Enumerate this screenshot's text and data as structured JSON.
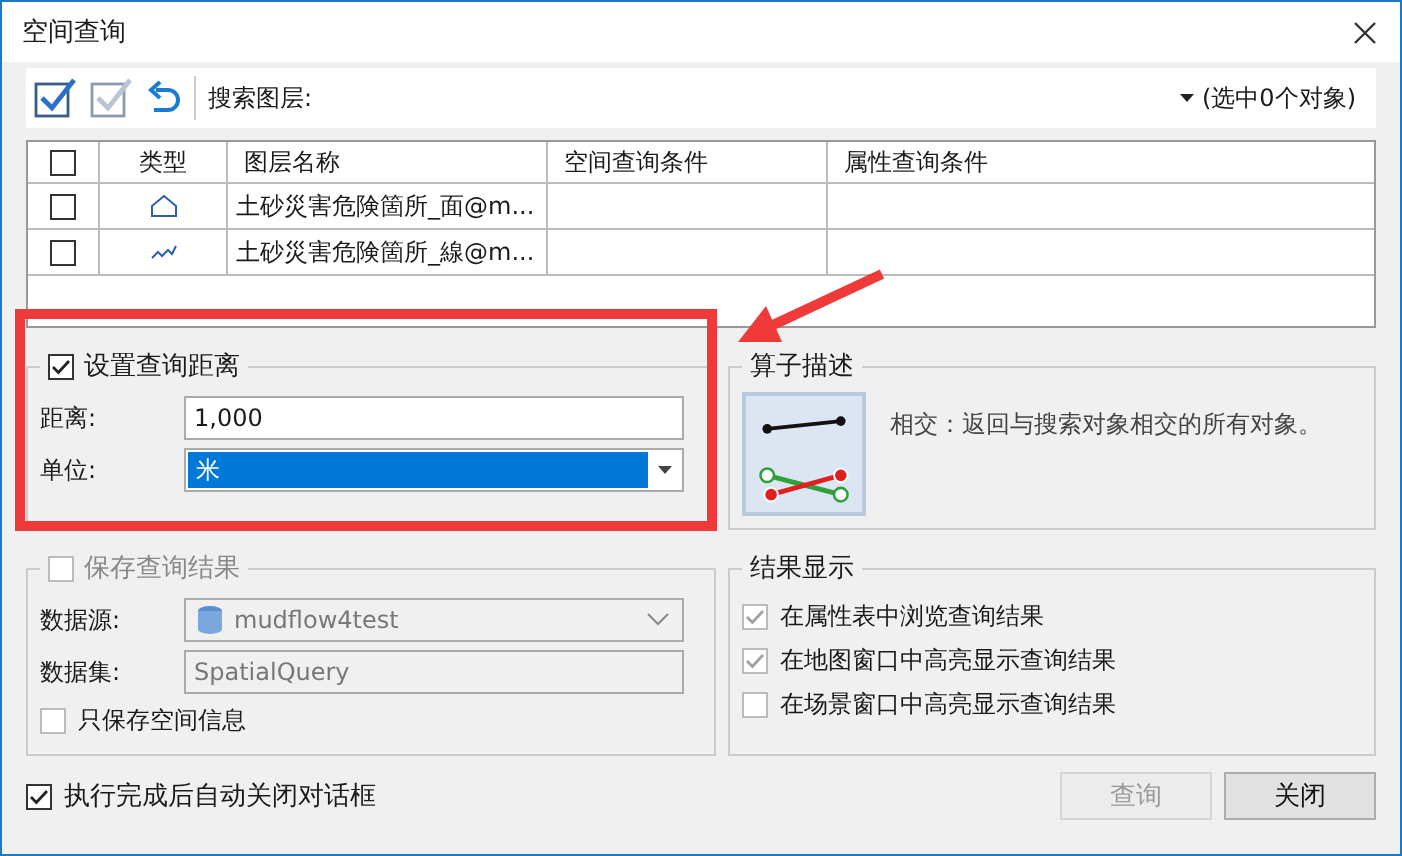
{
  "window": {
    "title": "空间查询"
  },
  "toolbar": {
    "search_label": "搜索图层:",
    "selection_count": "(选中0个对象)"
  },
  "table": {
    "header_checked": false,
    "columns": [
      "类型",
      "图层名称",
      "空间查询条件",
      "属性查询条件"
    ],
    "rows": [
      {
        "checked": false,
        "kind": "polygon",
        "layer_name": "土砂災害危険箇所_面@m..."
      },
      {
        "checked": false,
        "kind": "line",
        "layer_name": "土砂災害危険箇所_線@m..."
      }
    ]
  },
  "distance": {
    "checked": true,
    "title": "设置查询距离",
    "distance_label": "距离:",
    "distance_value": "1,000",
    "unit_label": "单位:",
    "unit_value": "米"
  },
  "operator": {
    "title": "算子描述",
    "description": "相交：返回与搜索对象相交的所有对象。"
  },
  "save": {
    "checked": false,
    "title": "保存查询结果",
    "datasource_label": "数据源:",
    "datasource_value": "mudflow4test",
    "dataset_label": "数据集:",
    "dataset_value": "SpatialQuery",
    "spatial_only_label": "只保存空间信息",
    "spatial_only_checked": false
  },
  "display": {
    "title": "结果显示",
    "options": [
      {
        "label": "在属性表中浏览查询结果",
        "checked": true
      },
      {
        "label": "在地图窗口中高亮显示查询结果",
        "checked": true
      },
      {
        "label": "在场景窗口中高亮显示查询结果",
        "checked": false
      }
    ]
  },
  "auto_close": {
    "label": "执行完成后自动关闭对话框",
    "checked": true
  },
  "buttons": [
    {
      "label": "查询",
      "disabled": true
    },
    {
      "label": "关闭",
      "disabled": false
    }
  ]
}
